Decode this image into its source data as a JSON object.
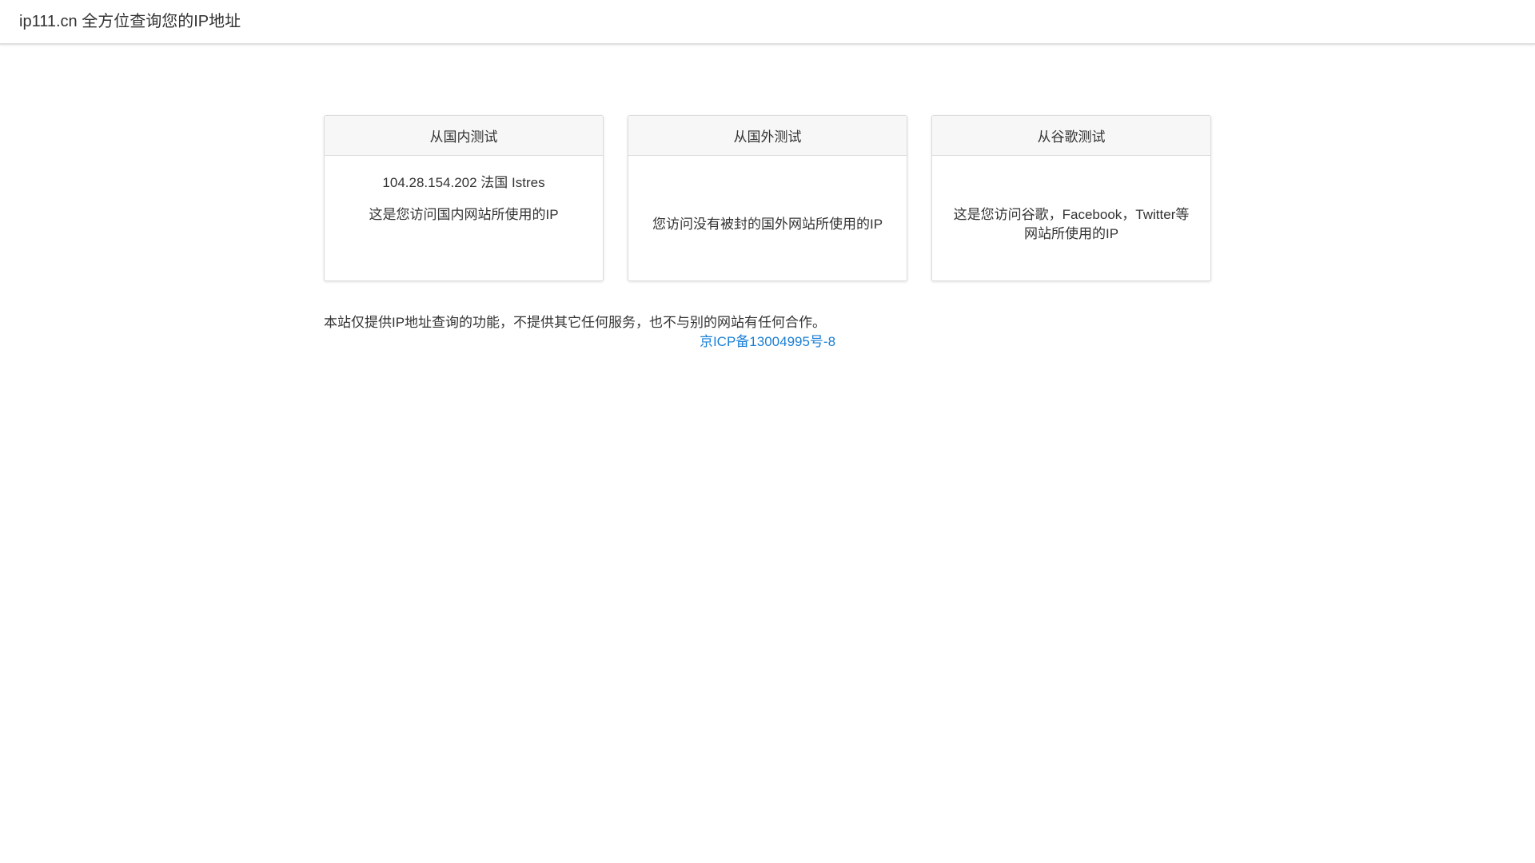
{
  "navbar": {
    "brand": "ip111.cn 全方位查询您的IP地址"
  },
  "cards": [
    {
      "header": "从国内测试",
      "ip_line": "104.28.154.202 法国 Istres",
      "description": "这是您访问国内网站所使用的IP"
    },
    {
      "header": "从国外测试",
      "ip_line": "",
      "description": "您访问没有被封的国外网站所使用的IP"
    },
    {
      "header": "从谷歌测试",
      "ip_line": "",
      "description": "这是您访问谷歌，Facebook，Twitter等网站所使用的IP"
    }
  ],
  "footer": {
    "notice": "本站仅提供IP地址查询的功能，不提供其它任何服务，也不与别的网站有任何合作。",
    "icp_link": "京ICP备13004995号-8"
  },
  "colors": {
    "link": "#1a7fd6",
    "card_header_bg": "#f7f7f7",
    "border": "#dcdcdc"
  }
}
